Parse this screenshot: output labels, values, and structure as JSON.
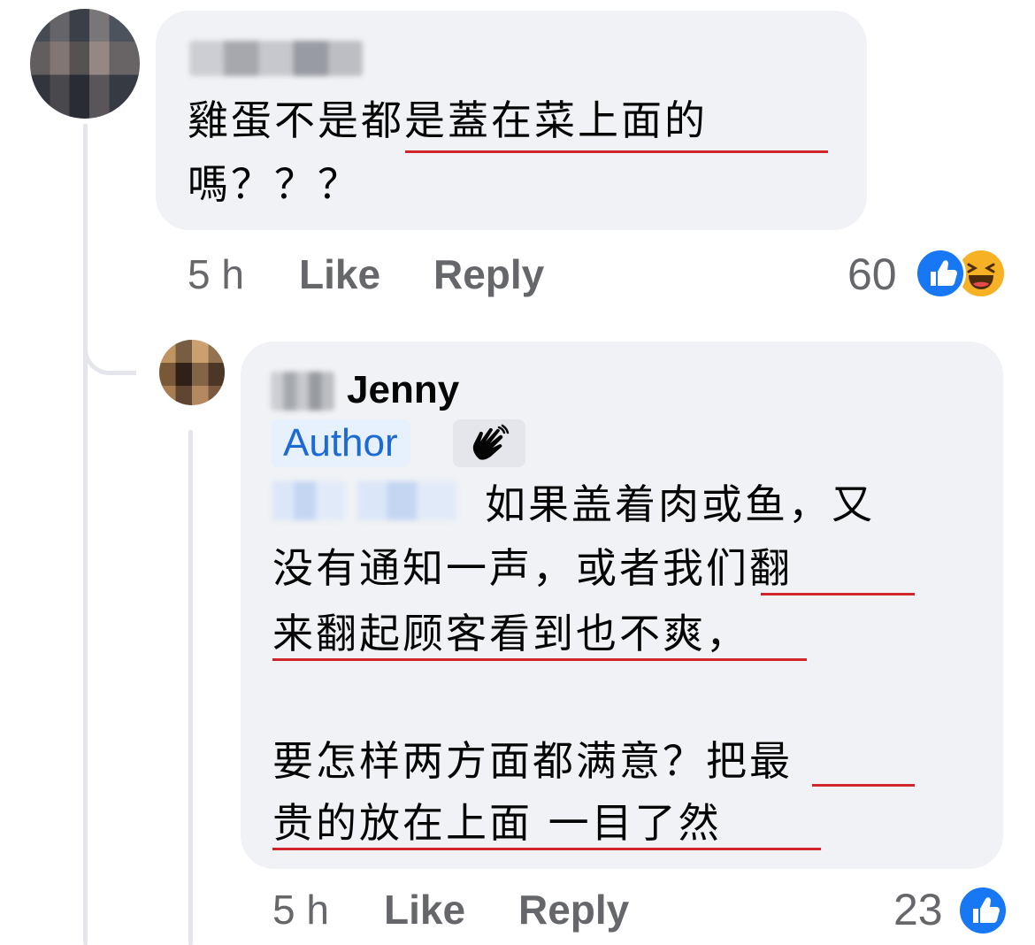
{
  "comment1": {
    "text_line1": "雞蛋不是都是蓋在菜上面的",
    "text_line2": "嗎？？？",
    "time": "5 h",
    "like_label": "Like",
    "reply_label": "Reply",
    "reaction_count": "60",
    "reactions": [
      "like-icon",
      "haha-icon"
    ]
  },
  "reply1": {
    "author_name": "Jenny",
    "author_badge": "Author",
    "badge_icon": "wave-icon",
    "line1": "如果盖着肉或鱼，又",
    "line2": "没有通知一声，或者我们翻",
    "line3": "来翻起顾客看到也不爽，",
    "line4": "要怎样两方面都满意？把最",
    "line5": "贵的放在上面 一目了然",
    "time": "5 h",
    "like_label": "Like",
    "reply_label": "Reply",
    "reaction_count": "23",
    "reactions": [
      "like-icon"
    ]
  },
  "colors": {
    "bubble": "#f0f2f5",
    "meta_text": "#65676b",
    "author_badge_text": "#1b6ad6",
    "underline": "#d0262b",
    "like_blue": "#1877f2"
  }
}
